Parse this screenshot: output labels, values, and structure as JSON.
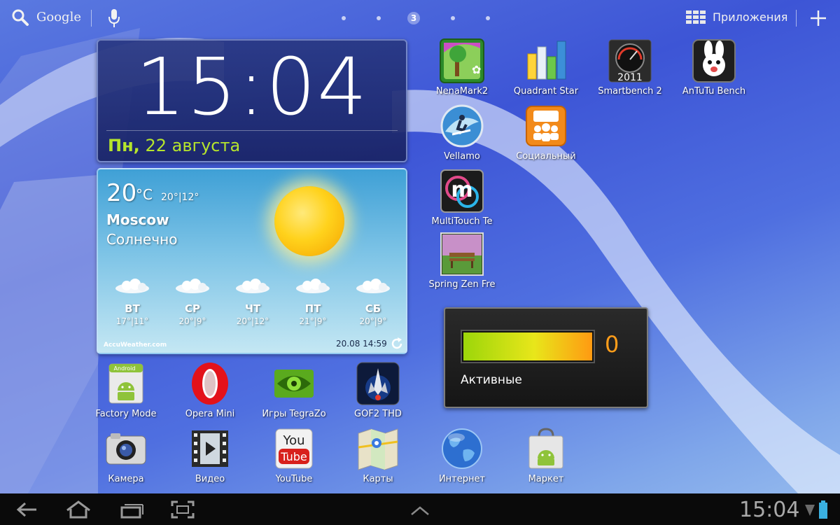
{
  "topbar": {
    "search_label": "Google",
    "current_page": "3",
    "apps_label": "Приложения"
  },
  "clock": {
    "time": "15:04",
    "day": "Пн,",
    "date": "22 августа"
  },
  "weather": {
    "temp": "20",
    "unit": "°C",
    "hilo": "20°|12°",
    "city": "Moscow",
    "condition": "Солнечно",
    "forecast": [
      {
        "day": "ВТ",
        "temp": "17°|11°"
      },
      {
        "day": "СР",
        "temp": "20°|9°"
      },
      {
        "day": "ЧТ",
        "temp": "20°|12°"
      },
      {
        "day": "ПТ",
        "temp": "21°|9°"
      },
      {
        "day": "СБ",
        "temp": "20°|9°"
      }
    ],
    "provider": "AccuWeather.com",
    "updated": "20.08 14:59"
  },
  "apps_top": [
    {
      "label": "NenaMark2"
    },
    {
      "label": "Quadrant Star"
    },
    {
      "label": "Smartbench 2"
    },
    {
      "label": "AnTuTu Bench"
    },
    {
      "label": "Vellamo"
    },
    {
      "label": "Социальный"
    },
    {
      "label": "MultiTouch Te"
    },
    {
      "label": "Spring Zen Fre"
    }
  ],
  "apps_row1": [
    {
      "label": "Factory Mode"
    },
    {
      "label": "Opera Mini"
    },
    {
      "label": "Игры TegraZo"
    },
    {
      "label": "GOF2 THD"
    }
  ],
  "apps_row2": [
    {
      "label": "Камера"
    },
    {
      "label": "Видео"
    },
    {
      "label": "YouTube"
    },
    {
      "label": "Карты"
    },
    {
      "label": "Интернет"
    },
    {
      "label": "Маркет"
    }
  ],
  "icon_text": {
    "smartbench": "2011",
    "youtube_you": "You",
    "youtube_tube": "Tube",
    "factory": "Android"
  },
  "task_manager": {
    "count": "0",
    "label": "Активные",
    "level": 1.0
  },
  "systembar": {
    "time": "15:04"
  },
  "colors": {
    "date_accent": "#b6e52c",
    "task_count": "#ff9d1a"
  }
}
